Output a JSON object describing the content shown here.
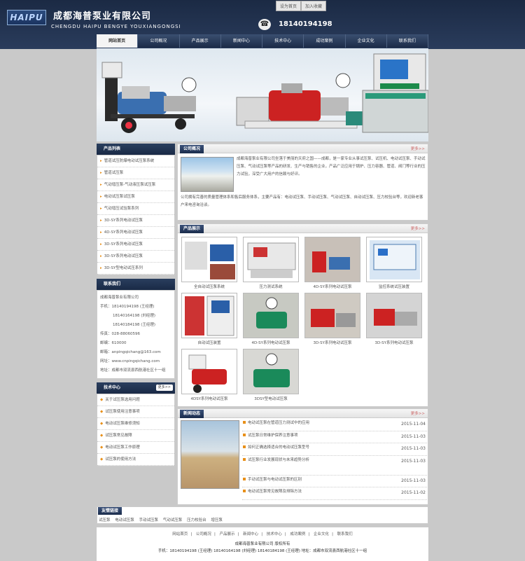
{
  "header": {
    "logo_text": "HAIPU",
    "company_cn": "成都海普泵业有限公司",
    "company_en": "CHENGDU HAIPU BENGYE YOUXIANGONGSI",
    "top_links": [
      "设为首页",
      "加入收藏"
    ],
    "phone": "18140194198",
    "phone_icon": "phone-icon"
  },
  "nav": [
    "网站首页",
    "公司概况",
    "产品展示",
    "新闻中心",
    "技术中心",
    "成功案例",
    "企业文化",
    "联系我们"
  ],
  "sidebar": {
    "products_title": "产品列表",
    "products": [
      "管道试压防爆电动试压泵系统",
      "管道试压泵",
      "气动增压泵-气动液压泵试压泵",
      "电动试压泵试压泵",
      "气动增压试验泵系列",
      "3D-SY系列电动试压泵",
      "4D-SY系列电动试压泵",
      "3D-SY系列电动试压泵",
      "3D-SY系列电动试压泵",
      "3D-SY型电动试压系列"
    ],
    "contact_title": "联系我们",
    "contact": [
      "成都海普泵业有限公司",
      "手机：18140194198 (王经理)",
      "18140164198 (刘经理)",
      "18140184198 (王经理)",
      "传真：028-88060596",
      "邮编：610000",
      "邮箱：anpingqichang@163.com",
      "网址：www.cnpingqichang.com",
      "地址：成都市双流县西航港社区十一组"
    ],
    "tech_title": "技术中心",
    "tech_more": "更多>>",
    "tech": [
      "关于试压泵选用问题",
      "试压泵使用注意事项",
      "电动试压泵维修须知",
      "试压泵常见故障",
      "电动试压泵工作原理",
      "试压泵的使用方法"
    ]
  },
  "about": {
    "title": "公司概况",
    "more": "更多>>",
    "text1": "成都海普泵业有限公司坐落于美丽的天府之国——成都，是一家专业从事试压泵、试压机、电动试压泵、手动试压泵、气动试压泵等产品的研发、生产与销售的企业，产品广泛应用于锅炉、压力容器、管道、阀门等行业的压力试验，深受广大用户的信赖与好评。",
    "text2": "公司拥有完善的质量管理体系和售后服务体系，主要产品有：电动试压泵、手动试压泵、气动试压泵、自动试压泵、压力校验台等，欢迎新老客户来电咨询洽谈。"
  },
  "products": {
    "title": "产品展示",
    "more": "更多>>",
    "items": [
      "全自动试压泵系统",
      "压力测试系统",
      "4D-SY系列电动试压泵",
      "监控系统试压装置",
      "自动试压装置",
      "4D-SY系列电动试压泵",
      "3D-SY系列电动试压泵",
      "3D-SY系列电动试压泵",
      "4DSY系列电动试压泵",
      "3DSY型电动试压泵"
    ]
  },
  "news": {
    "title": "新闻动态",
    "more": "更多>>",
    "items": [
      {
        "title": "电动试压泵在管道压力测试中的应用",
        "date": "2015-11-04"
      },
      {
        "title": "试压泵日常维护保养注意事项",
        "date": "2015-11-03"
      },
      {
        "title": "如何正确选择适合的电动试压泵型号",
        "date": "2015-11-03"
      },
      {
        "title": "试压泵行业发展现状与未来趋势分析",
        "date": "2015-11-03"
      },
      {
        "title": "手动试压泵与电动试压泵的区别",
        "date": "2015-11-03"
      },
      {
        "title": "电动试压泵常见故障及排除方法",
        "date": "2015-11-02"
      }
    ]
  },
  "links": {
    "title": "友情链接",
    "items": [
      "试压泵",
      "电动试压泵",
      "手动试压泵",
      "气动试压泵",
      "压力校验台",
      "增压泵"
    ]
  },
  "footer": {
    "nav": [
      "网站首页",
      "公司概况",
      "产品展示",
      "新闻中心",
      "技术中心",
      "成功案例",
      "企业文化",
      "联系我们"
    ],
    "line1": "成都海普泵业有限公司  版权所有",
    "line2": "手机：18140194198 (王经理)   18140164198 (刘经理)   18140184198 (王经理)   地址：成都市双流县西航港社区十一组"
  }
}
